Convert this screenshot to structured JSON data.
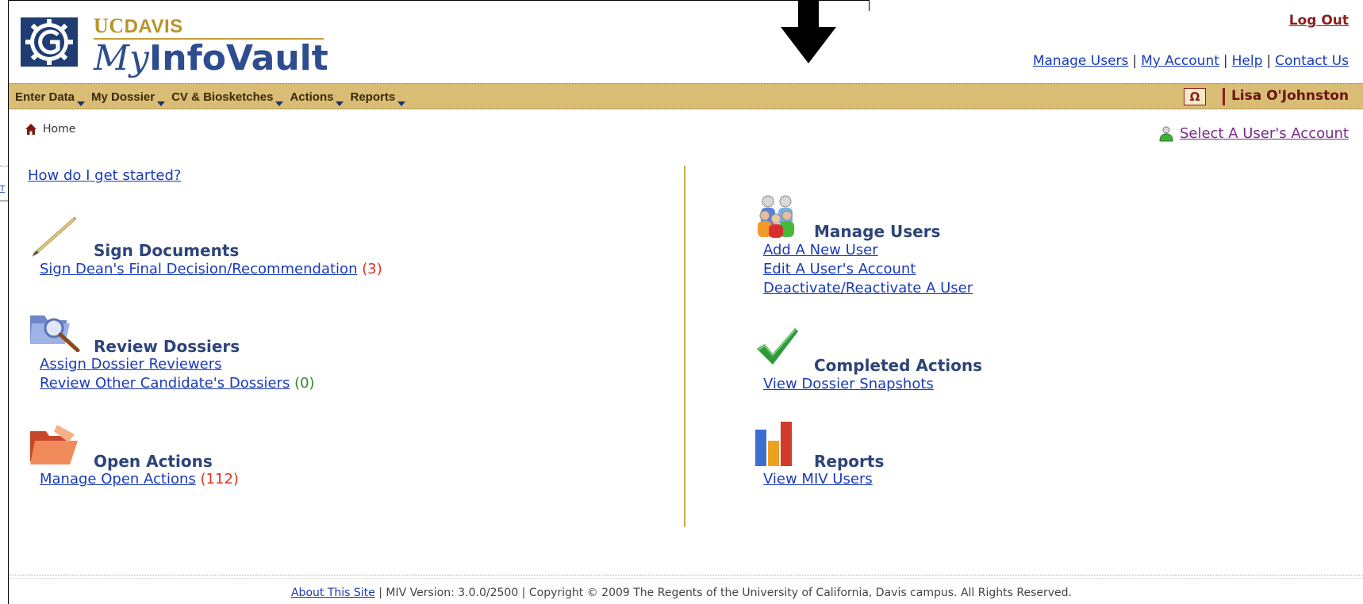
{
  "header": {
    "brand_uc": "UC",
    "brand_davis": "DAVIS",
    "brand_my": "My",
    "brand_infovault": "InfoVault",
    "logout": "Log Out",
    "toplinks": [
      "Manage Users",
      "My Account",
      "Help",
      "Contact Us"
    ],
    "separator": "|"
  },
  "menubar": {
    "items": [
      "Enter Data",
      "My Dossier",
      "CV & Biosketches",
      "Actions",
      "Reports"
    ],
    "omega": "Ω",
    "username": "Lisa O'Johnston"
  },
  "breadcrumb": {
    "home": "Home"
  },
  "select_user": "Select A User's Account",
  "get_started": "How do I get started?",
  "left_sections": {
    "sign": {
      "title": "Sign Documents",
      "link": "Sign Dean's Final Decision/Recommendation",
      "count": "(3)"
    },
    "review": {
      "title": "Review Dossiers",
      "link1": "Assign Dossier Reviewers",
      "link2": "Review Other Candidate's Dossiers",
      "count2": "(0)"
    },
    "open": {
      "title": "Open Actions",
      "link": "Manage Open Actions",
      "count": "(112)"
    }
  },
  "right_sections": {
    "manage": {
      "title": "Manage Users",
      "links": [
        "Add A New User",
        "Edit A User's Account",
        "Deactivate/Reactivate A User"
      ]
    },
    "completed": {
      "title": "Completed Actions",
      "link": "View Dossier Snapshots"
    },
    "reports": {
      "title": "Reports",
      "link": "View MIV Users"
    }
  },
  "footer": {
    "about": "About This Site",
    "rest": " | MIV Version: 3.0.0/2500 | Copyright © 2009 The Regents of the University of California, Davis campus. All Rights Reserved."
  },
  "edge_link": "T",
  "colors": {
    "menubar": "#d9bd75",
    "brand_gold": "#b8942a",
    "brand_blue": "#2d4d8f",
    "section_title": "#2d4478",
    "count_red": "#e03020",
    "count_green": "#2e8a2e",
    "link": "#1a3bb8"
  }
}
